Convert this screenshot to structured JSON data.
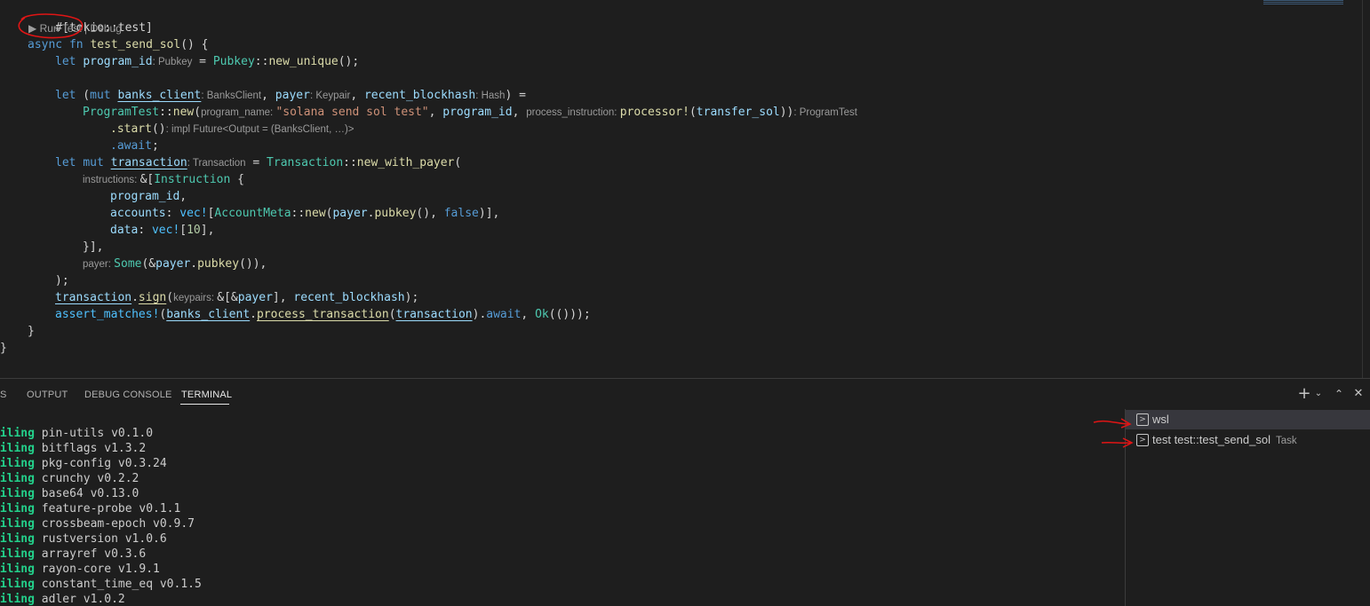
{
  "editor": {
    "attribute": "#[tokio::test]",
    "codelens": {
      "run_test": "▶ Run Test",
      "separator": " | ",
      "debug": "Debug"
    },
    "lines": {
      "l3_async": "async",
      "l3_fn": "fn",
      "l3_name": "test_send_sol",
      "l3_rest": "() {",
      "l4_let": "let",
      "l4_var": "program_id",
      "l4_hint": ": Pubkey",
      "l4_eq": " = ",
      "l4_ty": "Pubkey",
      "l4_sep": "::",
      "l4_fn": "new_unique",
      "l4_end": "();",
      "l6_let": "let",
      "l6_open": " (",
      "l6_mut": "mut",
      "l6_bc": "banks_client",
      "l6_bch": ": BanksClient",
      "l6_c1": ", ",
      "l6_payer": "payer",
      "l6_ph": ": Keypair",
      "l6_c2": ", ",
      "l6_rb": "recent_blockhash",
      "l6_rbh": ": Hash",
      "l6_end": ") =",
      "l7_ty": "ProgramTest",
      "l7_sep": "::",
      "l7_fn": "new",
      "l7_open": "(",
      "l7_h1": "program_name: ",
      "l7_str": "\"solana send sol test\"",
      "l7_c1": ", ",
      "l7_pid": "program_id",
      "l7_c2": ", ",
      "l7_h2": "process_instruction: ",
      "l7_mac": "processor!",
      "l7_p": "(",
      "l7_ts": "transfer_sol",
      "l7_end": "))",
      "l7_hint": ": ProgramTest",
      "l8_fn": ".start",
      "l8_p": "()",
      "l8_hint": ": impl Future<Output = (BanksClient, …)>",
      "l9_aw": ".await",
      "l9_end": ";",
      "l10_let": "let",
      "l10_mut": "mut",
      "l10_var": "transaction",
      "l10_hint": ": Transaction",
      "l10_eq": " = ",
      "l10_ty": "Transaction",
      "l10_sep": "::",
      "l10_fn": "new_with_payer",
      "l10_end": "(",
      "l11_hint": "instructions: ",
      "l11_amp": "&[",
      "l11_ty": "Instruction",
      "l11_end": " {",
      "l12_var": "program_id",
      "l12_end": ",",
      "l13_var": "accounts",
      "l13_c": ": ",
      "l13_mac": "vec!",
      "l13_b": "[",
      "l13_ty": "AccountMeta",
      "l13_sep": "::",
      "l13_fn": "new",
      "l13_p": "(",
      "l13_payer": "payer",
      "l13_dot": ".",
      "l13_pk": "pubkey",
      "l13_pp": "(), ",
      "l13_false": "false",
      "l13_end": ")],",
      "l14_var": "data",
      "l14_c": ": ",
      "l14_mac": "vec!",
      "l14_b": "[",
      "l14_num": "10",
      "l14_end": "],",
      "l15": "}],",
      "l16_hint": "payer: ",
      "l16_ty": "Some",
      "l16_p": "(&",
      "l16_payer": "payer",
      "l16_dot": ".",
      "l16_pk": "pubkey",
      "l16_end": "()),",
      "l17": ");",
      "l18_tx": "transaction",
      "l18_dot": ".",
      "l18_fn": "sign",
      "l18_p": "(",
      "l18_hint": "keypairs: ",
      "l18_a": "&[&",
      "l18_payer": "payer",
      "l18_m": "], ",
      "l18_rb": "recent_blockhash",
      "l18_end": ");",
      "l19_mac": "assert_matches!",
      "l19_p": "(",
      "l19_bc": "banks_client",
      "l19_dot": ".",
      "l19_fn": "process_transaction",
      "l19_p2": "(",
      "l19_tx": "transaction",
      "l19_p3": ").",
      "l19_aw": "await",
      "l19_c": ", ",
      "l19_ok": "Ok",
      "l19_end": "(()));",
      "l20": "}",
      "l21": "}"
    }
  },
  "panel": {
    "tabs": {
      "problems_partial": "S",
      "output": "OUTPUT",
      "debug_console": "DEBUG CONSOLE",
      "terminal": "TERMINAL"
    },
    "icons": {
      "new_terminal": "plus-icon",
      "dropdown": "chevron-down-icon",
      "maximize": "chevron-up-icon",
      "close": "close-icon"
    },
    "terminal_lines": [
      {
        "prefix": "piling",
        "text": "pin-utils v0.1.0"
      },
      {
        "prefix": "piling",
        "text": "bitflags v1.3.2"
      },
      {
        "prefix": "piling",
        "text": "pkg-config v0.3.24"
      },
      {
        "prefix": "piling",
        "text": "crunchy v0.2.2"
      },
      {
        "prefix": "piling",
        "text": "base64 v0.13.0"
      },
      {
        "prefix": "piling",
        "text": "feature-probe v0.1.1"
      },
      {
        "prefix": "piling",
        "text": "crossbeam-epoch v0.9.7"
      },
      {
        "prefix": "piling",
        "text": "rustversion v1.0.6"
      },
      {
        "prefix": "piling",
        "text": "arrayref v0.3.6"
      },
      {
        "prefix": "piling",
        "text": "rayon-core v1.9.1"
      },
      {
        "prefix": "piling",
        "text": "constant_time_eq v0.1.5"
      },
      {
        "prefix": "piling",
        "text": "adler v1.0.2"
      }
    ],
    "terminal_list": [
      {
        "label": "wsl",
        "desc": ""
      },
      {
        "label": "test test::test_send_sol",
        "desc": "Task"
      }
    ]
  },
  "colors": {
    "annotation": "#e01515",
    "terminal_green": "#23d18b"
  }
}
